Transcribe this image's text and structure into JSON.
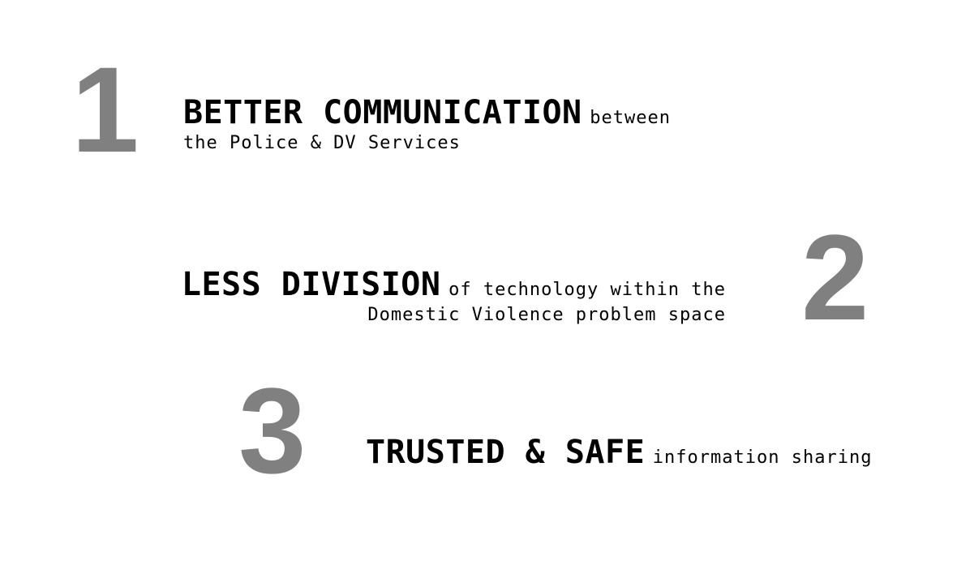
{
  "items": [
    {
      "number": "1",
      "heading": "BETTER COMMUNICATION",
      "text_inline": "between",
      "text_line2": "the Police & DV Services"
    },
    {
      "number": "2",
      "heading": "LESS DIVISION",
      "text_inline": "of technology within the",
      "text_line2": "Domestic Violence problem space"
    },
    {
      "number": "3",
      "heading": "TRUSTED & SAFE",
      "text_inline": "information sharing"
    }
  ],
  "colors": {
    "number": "#808080",
    "text": "#000000",
    "background": "#ffffff"
  }
}
